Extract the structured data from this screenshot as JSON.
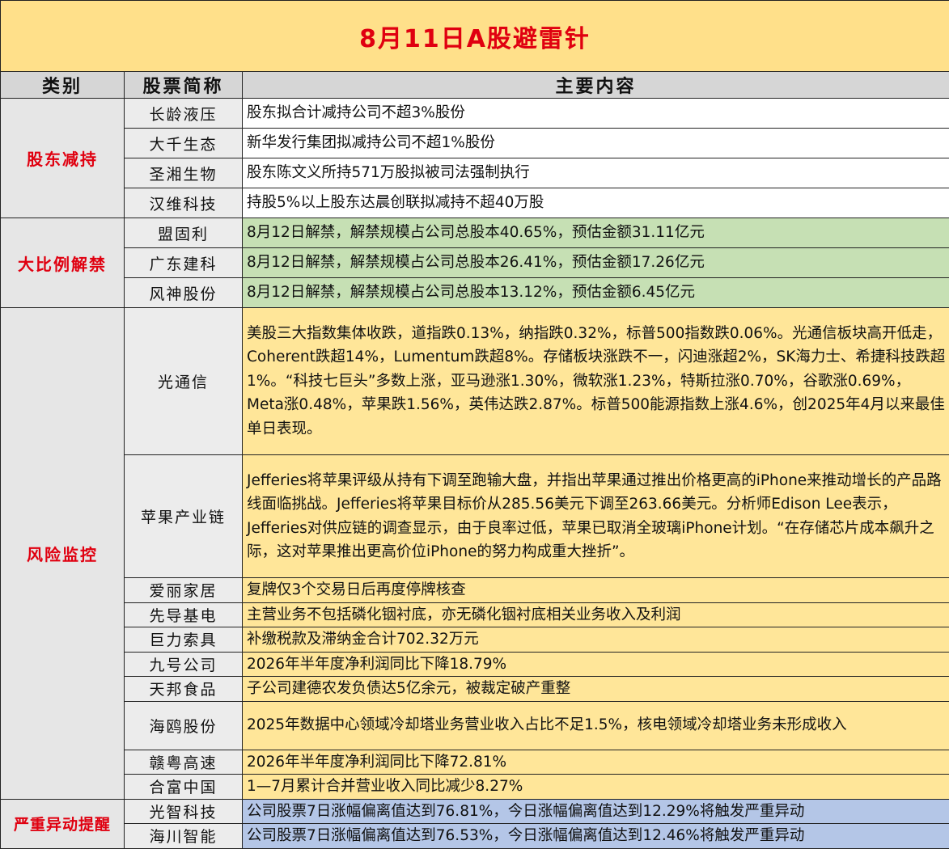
{
  "title": "8月11日A股避雷针",
  "headers": {
    "category": "类别",
    "stock": "股票简称",
    "content": "主要内容"
  },
  "sections": [
    {
      "category": "股东减持",
      "color": "#ffffff",
      "rows": [
        {
          "stock": "长龄液压",
          "content": "股东拟合计减持公司不超3%股份"
        },
        {
          "stock": "大千生态",
          "content": "新华发行集团拟减持公司不超1%股份"
        },
        {
          "stock": "圣湘生物",
          "content": "股东陈文义所持571万股拟被司法强制执行"
        },
        {
          "stock": "汉维科技",
          "content": "持股5%以上股东达晨创联拟减持不超40万股"
        }
      ]
    },
    {
      "category": "大比例解禁",
      "color": "#c6e0b4",
      "rows": [
        {
          "stock": "盟固利",
          "content": "8月12日解禁，解禁规模占公司总股本40.65%，预估金额31.11亿元"
        },
        {
          "stock": "广东建科",
          "content": "8月12日解禁，解禁规模占公司总股本26.41%，预估金额17.26亿元"
        },
        {
          "stock": "风神股份",
          "content": "8月12日解禁，解禁规模占公司总股本13.12%，预估金额6.45亿元"
        }
      ]
    },
    {
      "category": "风险监控",
      "color": "#ffe699",
      "rows": [
        {
          "stock": "光通信",
          "content": "美股三大指数集体收跌，道指跌0.13%，纳指跌0.32%，标普500指数跌0.06%。光通信板块高开低走，Coherent跌超14%，Lumentum跌超8%。存储板块涨跌不一，闪迪涨超2%，SK海力士、希捷科技跌超1%。“科技七巨头”多数上涨，亚马逊涨1.30%，微软涨1.23%，特斯拉涨0.70%，谷歌涨0.69%，Meta涨0.48%，苹果跌1.56%，英伟达跌2.87%。标普500能源指数上涨4.6%，创2025年4月以来最佳单日表现。"
        },
        {
          "stock": "苹果产业链",
          "content": "Jefferies将苹果评级从持有下调至跑输大盘，并指出苹果通过推出价格更高的iPhone来推动增长的产品路线面临挑战。Jefferies将苹果目标价从285.56美元下调至263.66美元。分析师Edison Lee表示，Jefferies对供应链的调查显示，由于良率过低，苹果已取消全玻璃iPhone计划。“在存储芯片成本飙升之际，这对苹果推出更高价位iPhone的努力构成重大挫折”。"
        },
        {
          "stock": "爱丽家居",
          "content": "复牌仅3个交易日后再度停牌核查"
        },
        {
          "stock": "先导基电",
          "content": "主营业务不包括磷化铟衬底，亦无磷化铟衬底相关业务收入及利润"
        },
        {
          "stock": "巨力索具",
          "content": "补缴税款及滞纳金合计702.32万元"
        },
        {
          "stock": "九号公司",
          "content": "2026年半年度净利润同比下降18.79%"
        },
        {
          "stock": "天邦食品",
          "content": "子公司建德农发负债达5亿余元，被裁定破产重整"
        },
        {
          "stock": "海鸥股份",
          "content": "2025年数据中心领域冷却塔业务营业收入占比不足1.5%，核电领域冷却塔业务未形成收入"
        },
        {
          "stock": "赣粤高速",
          "content": "2026年半年度净利润同比下降72.81%"
        },
        {
          "stock": "合富中国",
          "content": "1—7月累计合并营业收入同比减少8.27%"
        }
      ]
    },
    {
      "category": "严重异动提醒",
      "color": "#b4c6e7",
      "rows": [
        {
          "stock": "光智科技",
          "content": "公司股票7日涨幅偏离值达到76.81%，今日涨幅偏离值达到12.29%将触发严重异动"
        },
        {
          "stock": "海川智能",
          "content": "公司股票7日涨幅偏离值达到76.53%，今日涨幅偏离值达到12.46%将触发严重异动"
        }
      ]
    }
  ]
}
